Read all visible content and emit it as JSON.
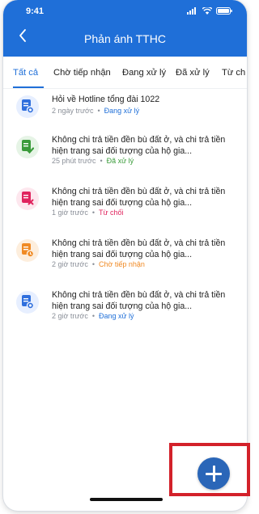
{
  "status": {
    "time": "9:41"
  },
  "header": {
    "title": "Phản ánh TTHC"
  },
  "tabs": [
    {
      "label": "Tất cả",
      "active": true
    },
    {
      "label": "Chờ tiếp nhận",
      "active": false
    },
    {
      "label": "Đang xử lý",
      "active": false
    },
    {
      "label": "Đã xử lý",
      "active": false
    },
    {
      "label": "Từ ch",
      "active": false
    }
  ],
  "items": [
    {
      "title": "Hỏi về Hotline tổng đài 1022",
      "time": "2 ngày trước",
      "status": "Đang xử lý",
      "status_color": "#1f6fd8",
      "icon": "document-info-icon",
      "icon_color": "#2f6fdd",
      "icon_bg": "#e7efff"
    },
    {
      "title": "Không chi trả tiền đền bù đất ở, và chi trả tiền hiện trang sai đối tượng của hộ gia...",
      "time": "25 phút trước",
      "status": "Đã xử lý",
      "status_color": "#3a9b3a",
      "icon": "document-check-icon",
      "icon_color": "#3a9b3a",
      "icon_bg": "#e6f4e6"
    },
    {
      "title": "Không chi trả tiền đền bù đất ở, và chi trả tiền hiện trang sai đối tượng của hộ gia...",
      "time": "1 giờ trước",
      "status": "Từ chối",
      "status_color": "#e0245e",
      "icon": "document-reject-icon",
      "icon_color": "#e0245e",
      "icon_bg": "#fde7ee"
    },
    {
      "title": "Không chi trả tiền đền bù đất ở, và chi trả tiền hiện trang sai đối tượng của hộ gia...",
      "time": "2 giờ trước",
      "status": "Chờ tiếp nhận",
      "status_color": "#f08a24",
      "icon": "document-pending-icon",
      "icon_color": "#f08a24",
      "icon_bg": "#fdeedd"
    },
    {
      "title": "Không chi trả tiền đền bù đất ở, và chi trả tiền hiện trang sai đối tượng của hộ gia...",
      "time": "2 giờ trước",
      "status": "Đang xử lý",
      "status_color": "#1f6fd8",
      "icon": "document-info-icon",
      "icon_color": "#2f6fdd",
      "icon_bg": "#e7efff"
    }
  ],
  "fab": {
    "icon": "plus-icon",
    "color": "#2a66b8"
  },
  "colors": {
    "brand": "#1f6fd8",
    "highlight": "#d3212a"
  }
}
